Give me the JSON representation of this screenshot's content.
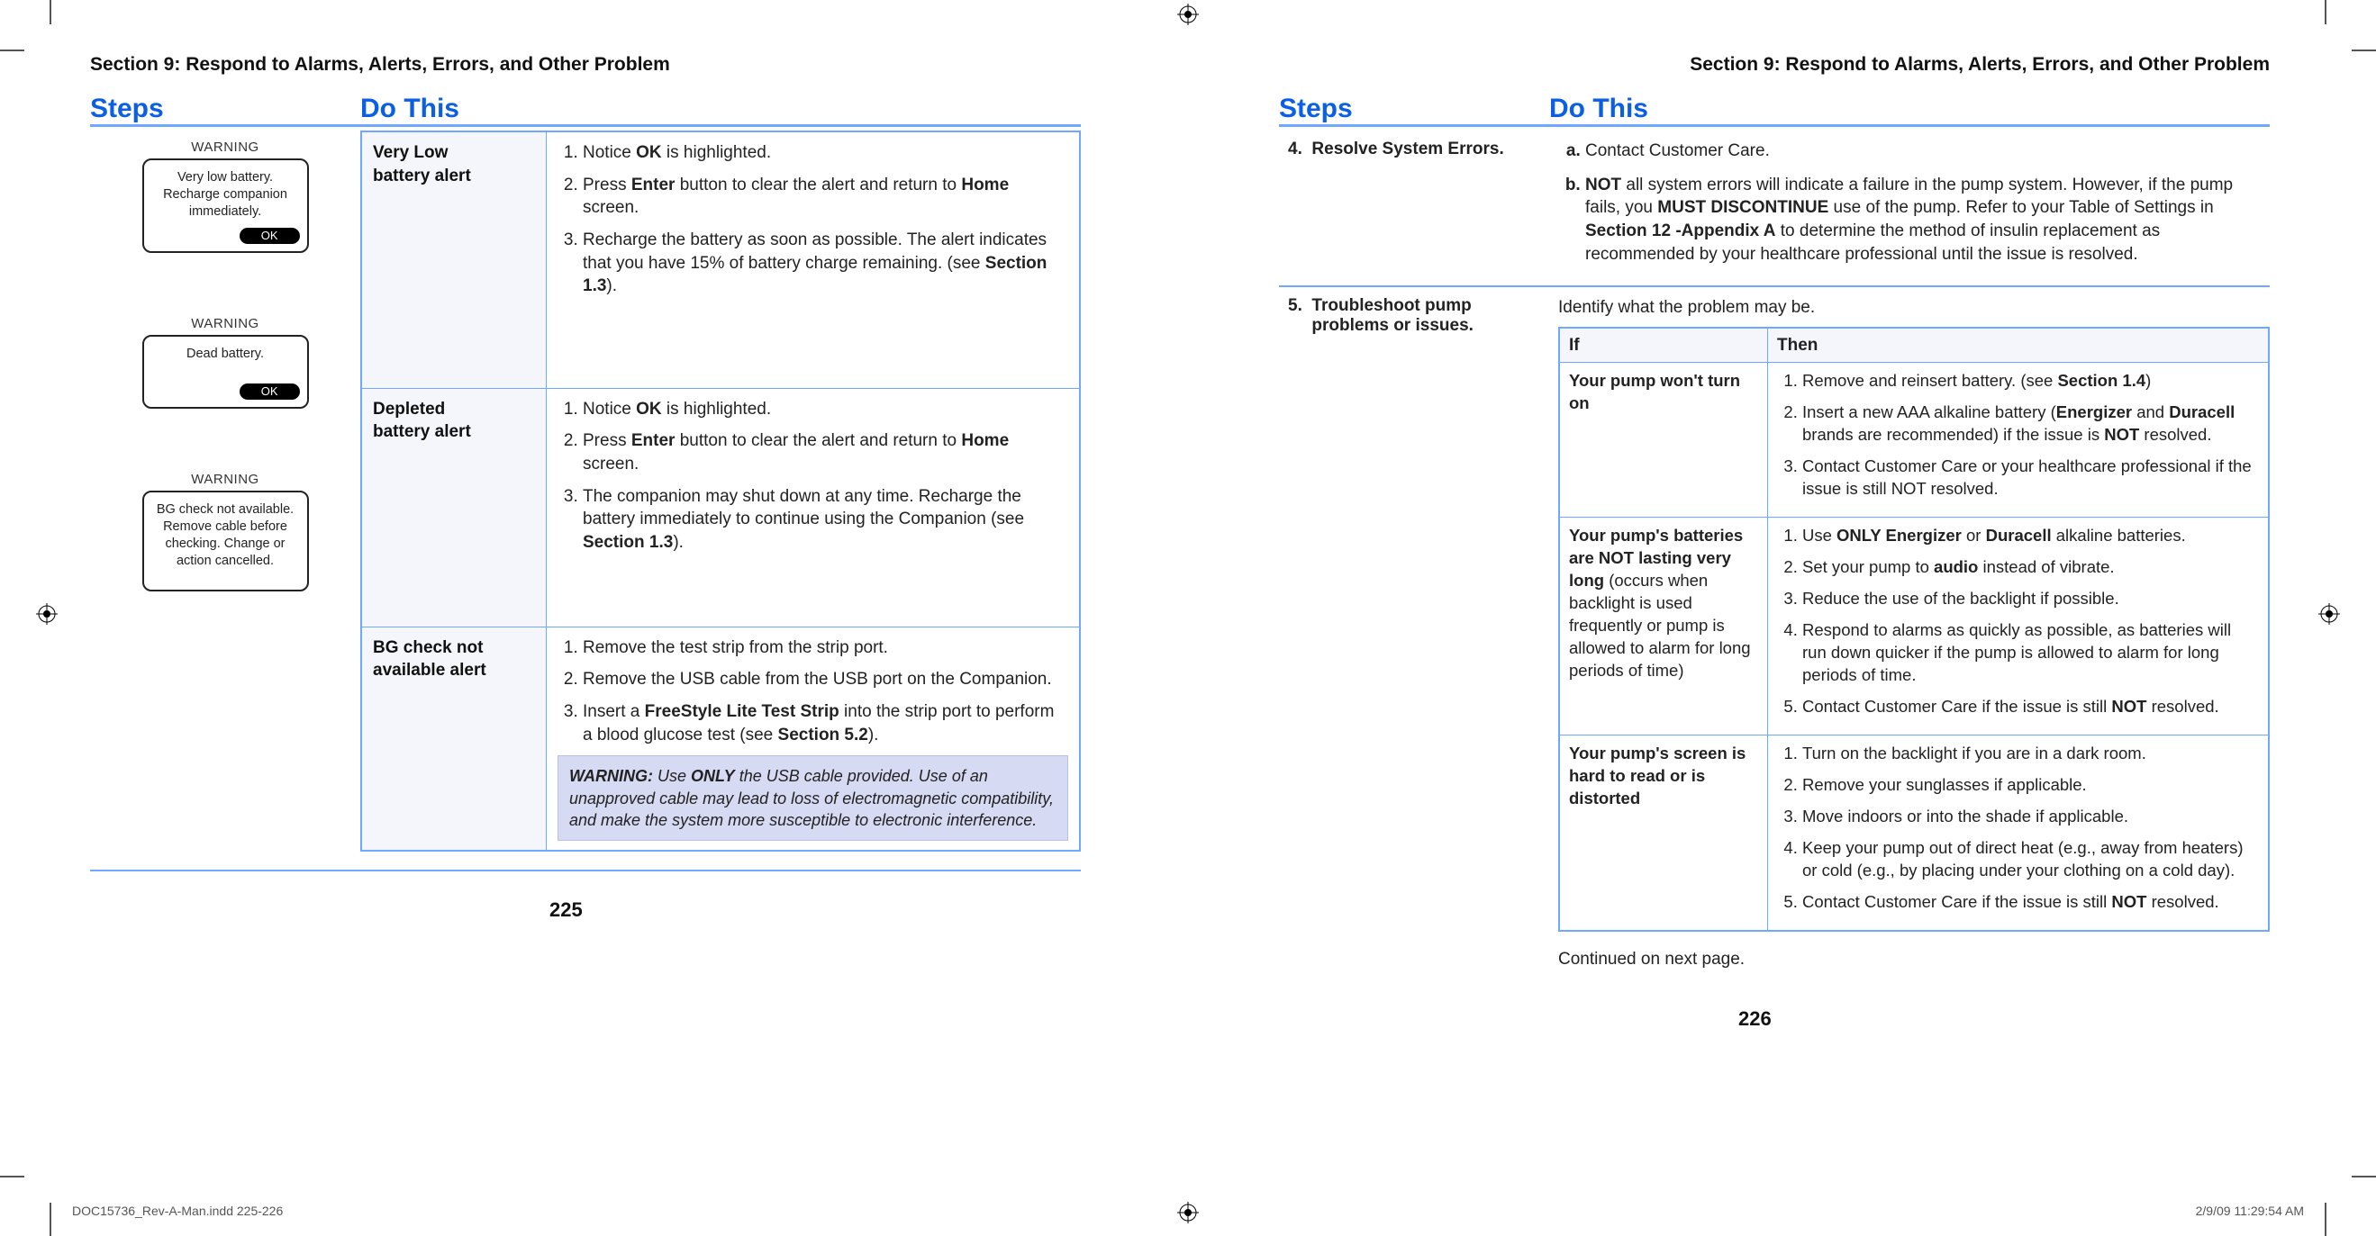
{
  "running_head": "Section 9: Respond to Alarms, Alerts, Errors, and Other Problem",
  "headers": {
    "steps": "Steps",
    "do_this": "Do This"
  },
  "page_left_num": "225",
  "page_right_num": "226",
  "imprint": "DOC15736_Rev-A-Man.indd   225-226",
  "timestamp": "2/9/09   11:29:54 AM",
  "devices": [
    {
      "title": "WARNING",
      "body": "Very low battery. Recharge companion immediately.",
      "has_ok": true
    },
    {
      "title": "WARNING",
      "body": "Dead battery.",
      "has_ok": true
    },
    {
      "title": "WARNING",
      "body": "BG check not available. Remove cable before checking.  Change or action cancelled.",
      "has_ok": false
    }
  ],
  "left_table": [
    {
      "label_line1": "Very Low",
      "label_line2": "battery alert",
      "items_html": [
        "Notice <b>OK</b> is highlighted.",
        "Press <b>Enter</b> button to clear the alert and return to <b>Home</b> screen.",
        "Recharge the battery as soon as possible. The alert indicates that you have 15% of battery charge remaining. (see <b>Section 1.3</b>)."
      ],
      "pad_bottom": 90
    },
    {
      "label_line1": "Depleted",
      "label_line2": "battery alert",
      "items_html": [
        "Notice <b>OK</b> is highlighted.",
        "Press <b>Enter</b> button to clear the alert and return to <b>Home</b> screen.",
        "The companion may shut down at any time. Recharge the battery immediately to continue using the Companion (see <b>Section 1.3</b>)."
      ],
      "pad_bottom": 70
    },
    {
      "label_line1": "BG check not",
      "label_line2": "available alert",
      "items_html": [
        "Remove the test strip from the strip port.",
        "Remove the USB cable from the USB port on the Companion.",
        "Insert a <b>FreeStyle Lite Test Strip</b> into the strip port to perform a blood glucose test (see <b>Section 5.2</b>)."
      ],
      "warning_html": "<b>WARNING:</b> Use <b>ONLY</b> the USB cable provided. Use of an unapproved cable may lead to loss of electromagnetic compatibility, and make the system more susceptible to electronic interference."
    }
  ],
  "right_steps": [
    {
      "num": "4.",
      "label": "Resolve System Errors.",
      "letters_html": [
        "Contact Customer Care.",
        "<b>NOT</b> all system errors will indicate a failure in the pump system. However, if the pump fails, you <b>MUST DISCONTINUE</b> use of the pump. Refer to your Table of Settings in <b>Section 12 -Appendix A</b> to determine the method of insulin replacement as recommended by your healthcare professional until the issue is resolved."
      ]
    }
  ],
  "troubleshoot": {
    "num": "5.",
    "label_line1": "Troubleshoot pump",
    "label_line2": "problems or issues.",
    "intro": "Identify what the problem may be.",
    "if_header": "If",
    "then_header": "Then",
    "rows": [
      {
        "if_html": "<b>Your pump won't turn on</b>",
        "then_html": [
          "Remove and reinsert battery. (see <b>Section 1.4</b>)",
          "Insert a new AAA alkaline battery (<b>Energizer</b> and <b>Duracell</b> brands are recommended) if the issue is <b>NOT</b> resolved.",
          "Contact Customer Care or your healthcare professional if the issue is still NOT resolved."
        ]
      },
      {
        "if_html": "<b>Your pump's batteries are NOT lasting very long</b> <span class='light'>(occurs when backlight is used frequently or pump is allowed to alarm for long periods of time)</span>",
        "then_html": [
          "Use <b>ONLY Energizer</b> or <b>Duracell</b> alkaline batteries.",
          "Set your pump to <b>audio</b> instead of vibrate.",
          "Reduce the use of the backlight if possible.",
          "Respond to alarms as quickly as possible, as batteries will run down quicker if the pump is allowed to alarm for long periods of time.",
          "Contact Customer Care if the issue is still <b>NOT</b> resolved."
        ]
      },
      {
        "if_html": "<b>Your pump's screen is hard to read or is distorted</b>",
        "then_html": [
          "Turn on the backlight if you are in a dark room.",
          "Remove your sunglasses if applicable.",
          "Move indoors or into the shade if applicable.",
          "Keep your pump out of direct heat (e.g., away from heaters) or cold (e.g., by placing under your clothing on a cold day).",
          "Contact Customer Care if the issue is still <b>NOT</b> resolved."
        ]
      }
    ],
    "continued": "Continued on next page."
  }
}
